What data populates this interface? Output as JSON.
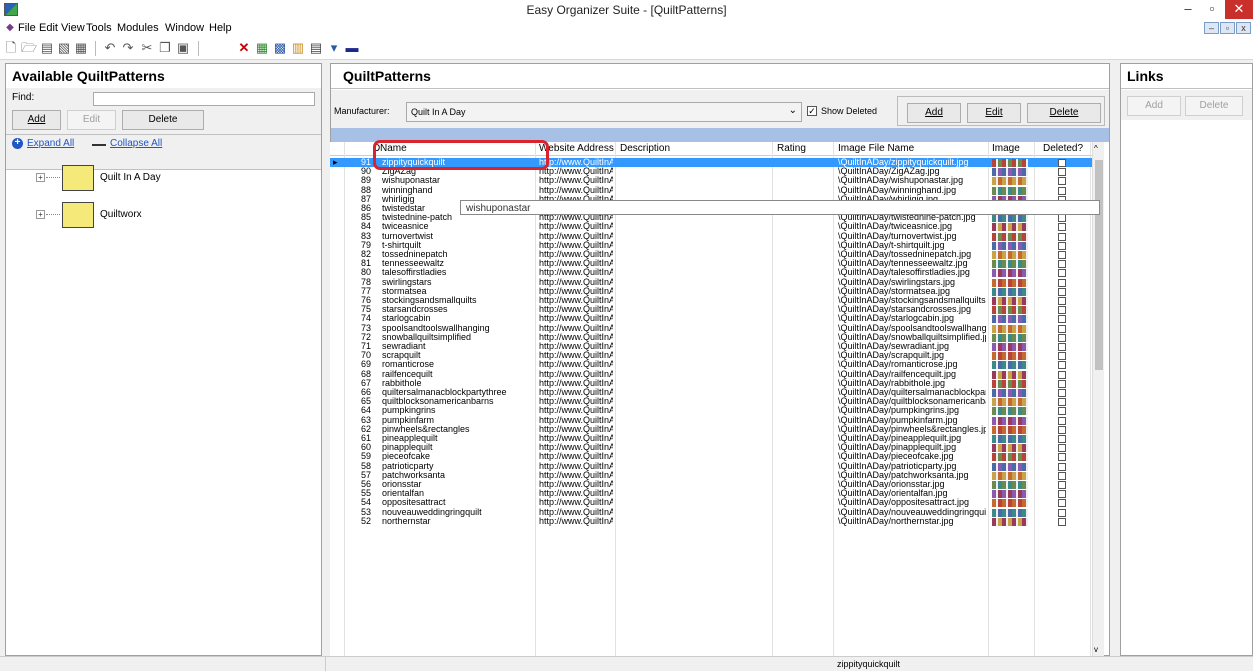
{
  "window": {
    "title": "Easy Organizer Suite - [QuiltPatterns]",
    "minimize": "–",
    "maximize": "▫",
    "close": "✕"
  },
  "menu": {
    "file": "File",
    "edit": "Edit",
    "view": "View",
    "tools": "Tools",
    "modules": "Modules",
    "window": "Window",
    "help": "Help"
  },
  "left": {
    "title": "Available QuiltPatterns",
    "find_label": "Find:",
    "find_value": "",
    "add": "Add",
    "edit": "Edit",
    "delete": "Delete",
    "expand_all": "Expand All",
    "collapse_all": "Collapse All",
    "tree": [
      {
        "label": "Quilt In A Day"
      },
      {
        "label": "Quiltworx"
      }
    ]
  },
  "center": {
    "title": "QuiltPatterns",
    "manufacturer_label": "Manufacturer:",
    "manufacturer_value": "Quilt In A Day",
    "show_deleted": "Show Deleted",
    "show_deleted_checked": true,
    "add": "Add",
    "edit": "Edit",
    "delete": "Delete",
    "columns": {
      "id": "D",
      "name": "Name",
      "website": "Website Address",
      "description": "Description",
      "rating": "Rating",
      "image_file": "Image File Name",
      "image": "Image",
      "deleted": "Deleted?"
    },
    "tooltip": "wishuponastar",
    "rows": [
      {
        "id": "91",
        "name": "zippityquickquilt",
        "web": "http://www.QuiltInA",
        "file": "\\QuiltInADay/zippityquickquilt.jpg",
        "selected": true
      },
      {
        "id": "90",
        "name": "ZigAZag",
        "web": "http://www.QuiltInA",
        "file": "\\QuiltInADay/ZigAZag.jpg"
      },
      {
        "id": "89",
        "name": "wishuponastar",
        "web": "http://www.QuiltInA",
        "file": "\\QuiltInADay/wishuponastar.jpg"
      },
      {
        "id": "88",
        "name": "winninghand",
        "web": "http://www.QuiltInA",
        "file": "\\QuiltInADay/winninghand.jpg"
      },
      {
        "id": "87",
        "name": "whirligig",
        "web": "http://www.QuiltInA",
        "file": "\\QuiltInADay/whirligig.jpg"
      },
      {
        "id": "86",
        "name": "twistedstar",
        "web": "http://www.QuiltInA",
        "file": "\\QuiltInADay/twistedstar.jpg"
      },
      {
        "id": "85",
        "name": "twistednine-patch",
        "web": "http://www.QuiltInA",
        "file": "\\QuiltInADay/twistednine-patch.jpg"
      },
      {
        "id": "84",
        "name": "twiceasnice",
        "web": "http://www.QuiltInA",
        "file": "\\QuiltInADay/twiceasnice.jpg"
      },
      {
        "id": "83",
        "name": "turnovertwist",
        "web": "http://www.QuiltInA",
        "file": "\\QuiltInADay/turnovertwist.jpg"
      },
      {
        "id": "79",
        "name": "t-shirtquilt",
        "web": "http://www.QuiltInA",
        "file": "\\QuiltInADay/t-shirtquilt.jpg"
      },
      {
        "id": "82",
        "name": "tossedninepatch",
        "web": "http://www.QuiltInA",
        "file": "\\QuiltInADay/tossedninepatch.jpg"
      },
      {
        "id": "81",
        "name": "tennesseewaltz",
        "web": "http://www.QuiltInA",
        "file": "\\QuiltInADay/tennesseewaltz.jpg"
      },
      {
        "id": "80",
        "name": "talesoffirstladies",
        "web": "http://www.QuiltInA",
        "file": "\\QuiltInADay/talesoffirstladies.jpg"
      },
      {
        "id": "78",
        "name": "swirlingstars",
        "web": "http://www.QuiltInA",
        "file": "\\QuiltInADay/swirlingstars.jpg"
      },
      {
        "id": "77",
        "name": "stormatsea",
        "web": "http://www.QuiltInA",
        "file": "\\QuiltInADay/stormatsea.jpg"
      },
      {
        "id": "76",
        "name": "stockingsandsmallquilts",
        "web": "http://www.QuiltInA",
        "file": "\\QuiltInADay/stockingsandsmallquilts.jp"
      },
      {
        "id": "75",
        "name": "starsandcrosses",
        "web": "http://www.QuiltInA",
        "file": "\\QuiltInADay/starsandcrosses.jpg"
      },
      {
        "id": "74",
        "name": "starlogcabin",
        "web": "http://www.QuiltInA",
        "file": "\\QuiltInADay/starlogcabin.jpg"
      },
      {
        "id": "73",
        "name": "spoolsandtoolswallhanging",
        "web": "http://www.QuiltInA",
        "file": "\\QuiltInADay/spoolsandtoolswallhangin"
      },
      {
        "id": "72",
        "name": "snowballquiltsimplified",
        "web": "http://www.QuiltInA",
        "file": "\\QuiltInADay/snowballquiltsimplified.jpg"
      },
      {
        "id": "71",
        "name": "sewradiant",
        "web": "http://www.QuiltInA",
        "file": "\\QuiltInADay/sewradiant.jpg"
      },
      {
        "id": "70",
        "name": "scrapquilt",
        "web": "http://www.QuiltInA",
        "file": "\\QuiltInADay/scrapquilt.jpg"
      },
      {
        "id": "69",
        "name": "romanticrose",
        "web": "http://www.QuiltInA",
        "file": "\\QuiltInADay/romanticrose.jpg"
      },
      {
        "id": "68",
        "name": "railfencequilt",
        "web": "http://www.QuiltInA",
        "file": "\\QuiltInADay/railfencequilt.jpg"
      },
      {
        "id": "67",
        "name": "rabbithole",
        "web": "http://www.QuiltInA",
        "file": "\\QuiltInADay/rabbithole.jpg"
      },
      {
        "id": "66",
        "name": "quiltersalmanacblockpartythree",
        "web": "http://www.QuiltInA",
        "file": "\\QuiltInADay/quiltersalmanacblockpartyt"
      },
      {
        "id": "65",
        "name": "quiltblocksonamericanbarns",
        "web": "http://www.QuiltInA",
        "file": "\\QuiltInADay/quiltblocksonamericanbar"
      },
      {
        "id": "64",
        "name": "pumpkingrins",
        "web": "http://www.QuiltInA",
        "file": "\\QuiltInADay/pumpkingrins.jpg"
      },
      {
        "id": "63",
        "name": "pumpkinfarm",
        "web": "http://www.QuiltInA",
        "file": "\\QuiltInADay/pumpkinfarm.jpg"
      },
      {
        "id": "62",
        "name": "pinwheels&rectangles",
        "web": "http://www.QuiltInA",
        "file": "\\QuiltInADay/pinwheels&rectangles.jpg"
      },
      {
        "id": "61",
        "name": "pineapplequilt",
        "web": "http://www.QuiltInA",
        "file": "\\QuiltInADay/pineapplequilt.jpg"
      },
      {
        "id": "60",
        "name": "pinapplequilt",
        "web": "http://www.QuiltInA",
        "file": "\\QuiltInADay/pinapplequilt.jpg"
      },
      {
        "id": "59",
        "name": "pieceofcake",
        "web": "http://www.QuiltInA",
        "file": "\\QuiltInADay/pieceofcake.jpg"
      },
      {
        "id": "58",
        "name": "patrioticparty",
        "web": "http://www.QuiltInA",
        "file": "\\QuiltInADay/patrioticparty.jpg"
      },
      {
        "id": "57",
        "name": "patchworksanta",
        "web": "http://www.QuiltInA",
        "file": "\\QuiltInADay/patchworksanta.jpg"
      },
      {
        "id": "56",
        "name": "orionsstar",
        "web": "http://www.QuiltInA",
        "file": "\\QuiltInADay/orionsstar.jpg"
      },
      {
        "id": "55",
        "name": "orientalfan",
        "web": "http://www.QuiltInA",
        "file": "\\QuiltInADay/orientalfan.jpg"
      },
      {
        "id": "54",
        "name": "oppositesattract",
        "web": "http://www.QuiltInA",
        "file": "\\QuiltInADay/oppositesattract.jpg"
      },
      {
        "id": "53",
        "name": "nouveauweddingringquilt",
        "web": "http://www.QuiltInA",
        "file": "\\QuiltInADay/nouveauweddingringquilt.j"
      },
      {
        "id": "52",
        "name": "northernstar",
        "web": "http://www.QuiltInA",
        "file": "\\QuiltInADay/northernstar.jpg"
      }
    ]
  },
  "right": {
    "title": "Links",
    "add": "Add",
    "delete": "Delete"
  },
  "status": {
    "text": "zippityquickquilt"
  },
  "colors": {
    "selection": "#3399ff",
    "highlight": "#d9232d",
    "folder": "#f5e97a",
    "header_strip": "#a7c1e6"
  }
}
